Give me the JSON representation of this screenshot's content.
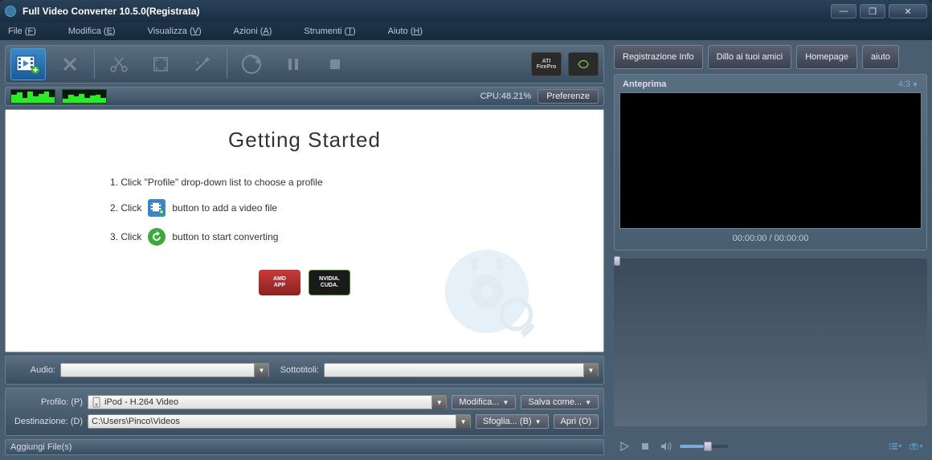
{
  "titlebar": {
    "title": "Full Video Converter 10.5.0(Registrata)"
  },
  "menu": {
    "file": "File",
    "file_k": "F",
    "edit": "Modifica",
    "edit_k": "E",
    "view": "Visualizza",
    "view_k": "V",
    "actions": "Azioni",
    "actions_k": "A",
    "tools": "Strumenti",
    "tools_k": "T",
    "help": "Aiuto",
    "help_k": "H"
  },
  "status": {
    "cpu": "CPU:48.21%",
    "preferences": "Preferenze"
  },
  "gs": {
    "title": "Getting Started",
    "s1a": "1. Click \"Profile\" drop-down list to choose a profile",
    "s2a": "2. Click",
    "s2b": "button to add a video file",
    "s3a": "3. Click",
    "s3b": "button to start converting"
  },
  "logos": {
    "amd": "AMD\nAPP",
    "nvidia": "NVIDIA.\nCUDA.",
    "ati": "ATI\nFirePro",
    "cuda": "CUDA"
  },
  "controls": {
    "audio": "Audio:",
    "subtitle": "Sottotitoli:",
    "profile": "Profilo: (P)",
    "profile_val": "iPod - H.264 Video",
    "dest": "Destinazione: (D)",
    "dest_val": "C:\\Users\\Pinco\\Videos",
    "modify": "Modifica...",
    "saveas": "Salva come...",
    "browse": "Sfoglia...  (B)",
    "open": "Apri (O)"
  },
  "statusbar2": "Aggiungi File(s)",
  "right": {
    "reg": "Registrazione Info",
    "tell": "Dillo ai tuoi amici",
    "home": "Homepage",
    "help": "aiuto",
    "preview": "Anteprima",
    "ratio": "4:3",
    "time": "00:00:00 / 00:00:00"
  }
}
